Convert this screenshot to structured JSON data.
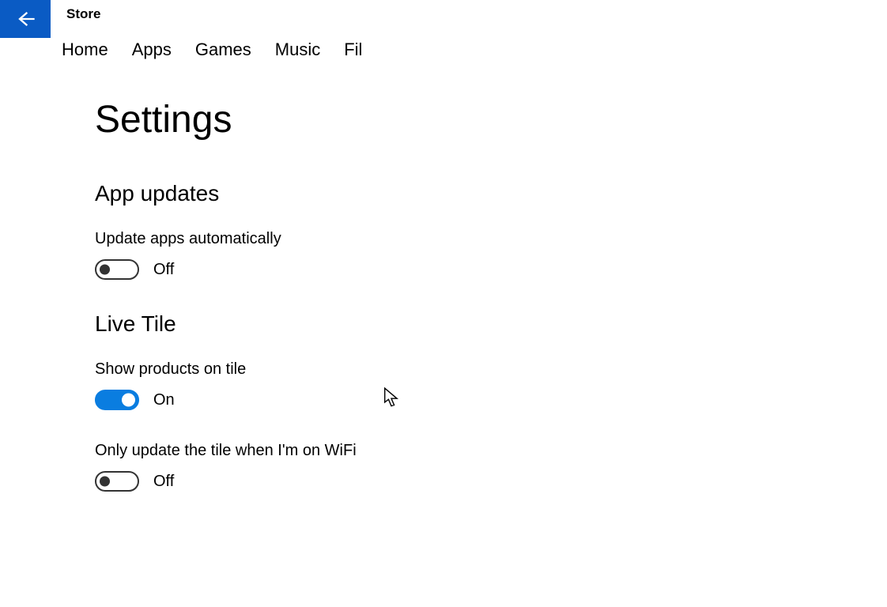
{
  "app": {
    "title": "Store"
  },
  "tabs": [
    {
      "label": "Home"
    },
    {
      "label": "Apps"
    },
    {
      "label": "Games"
    },
    {
      "label": "Music"
    },
    {
      "label": "Fil"
    }
  ],
  "page": {
    "title": "Settings"
  },
  "sections": {
    "app_updates": {
      "title": "App updates",
      "auto_update": {
        "label": "Update apps automatically",
        "state": "Off",
        "on": false
      }
    },
    "live_tile": {
      "title": "Live Tile",
      "show_products": {
        "label": "Show products on tile",
        "state": "On",
        "on": true
      },
      "wifi_only": {
        "label": "Only update the tile when I'm on WiFi",
        "state": "Off",
        "on": false
      }
    }
  },
  "colors": {
    "accent": "#0a5bc4",
    "toggle_on": "#0a7de0"
  }
}
